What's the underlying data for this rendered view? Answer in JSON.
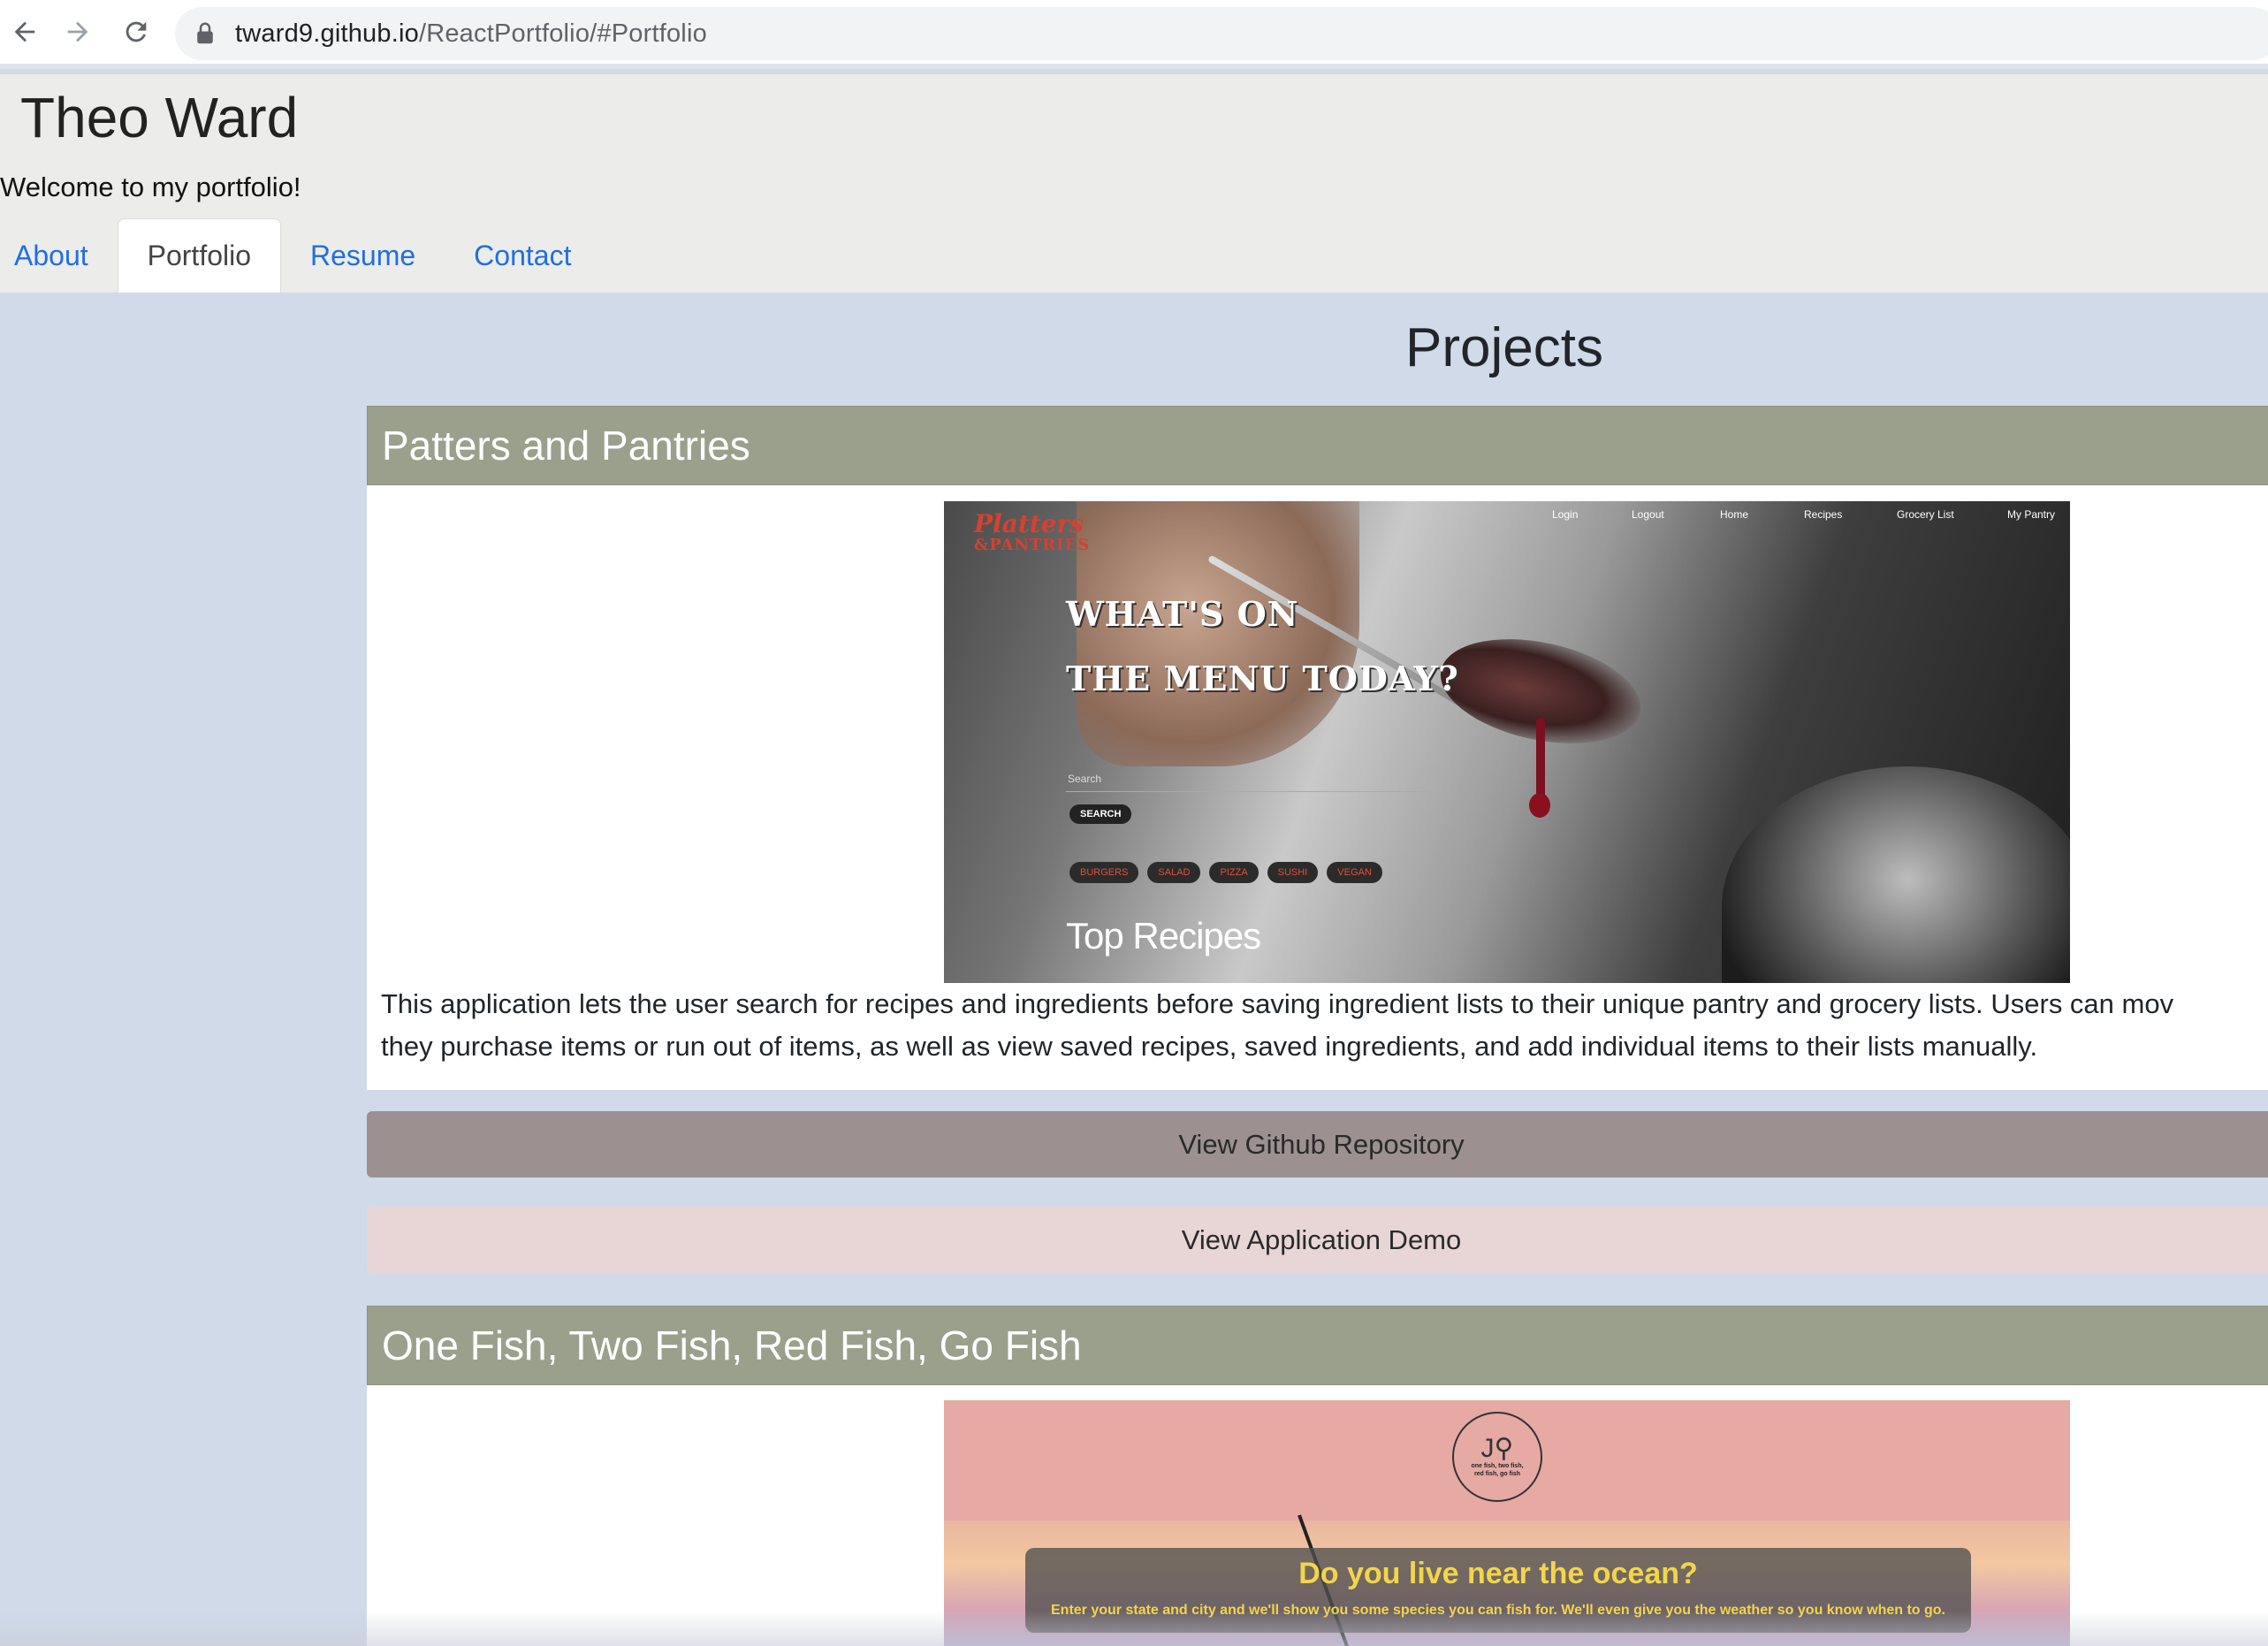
{
  "browser": {
    "url_host": "tward9.github.io",
    "url_path": "/ReactPortfolio/#Portfolio"
  },
  "header": {
    "title": "Theo Ward",
    "welcome": "Welcome to my portfolio!",
    "tabs": [
      {
        "label": "About",
        "active": false
      },
      {
        "label": "Portfolio",
        "active": true
      },
      {
        "label": "Resume",
        "active": false
      },
      {
        "label": "Contact",
        "active": false
      }
    ]
  },
  "main": {
    "heading": "Projects",
    "projects": [
      {
        "title": "Patters and Pantries",
        "screenshot": {
          "logo_line1": "Platters",
          "logo_line2": "&PANTRIES",
          "nav": [
            "Login",
            "Logout",
            "Home",
            "Recipes",
            "Grocery List",
            "My Pantry"
          ],
          "headline_line1": "WHAT'S ON",
          "headline_line2": "THE MENU TODAY?",
          "search_placeholder": "Search",
          "search_button": "SEARCH",
          "chips": [
            "BURGERS",
            "SALAD",
            "PIZZA",
            "SUSHI",
            "VEGAN"
          ],
          "section": "Top Recipes"
        },
        "description_line1": "This application lets the user search for recipes and ingredients before saving ingredient lists to their unique pantry and grocery lists. Users can mov",
        "description_line2": "they purchase items or run out of items, as well as view saved recipes, saved ingredients, and add individual items to their lists manually.",
        "github_label": "View Github Repository",
        "demo_label": "View Application Demo"
      },
      {
        "title": "One Fish, Two Fish, Red Fish, Go Fish",
        "screenshot": {
          "logo_text": "one fish, two fish, red fish, go fish",
          "question": "Do you live near the ocean?",
          "subtext": "Enter your state and city and we'll show you some species you can fish for. We'll even give you the weather so you know when to go."
        }
      }
    ]
  },
  "colors": {
    "page_bg": "#d0dae9",
    "header_bg": "#ececea",
    "card_header": "#9ba08c",
    "github_button": "#9c9190",
    "demo_button": "#e8d5d6",
    "link": "#1f6fe0"
  }
}
